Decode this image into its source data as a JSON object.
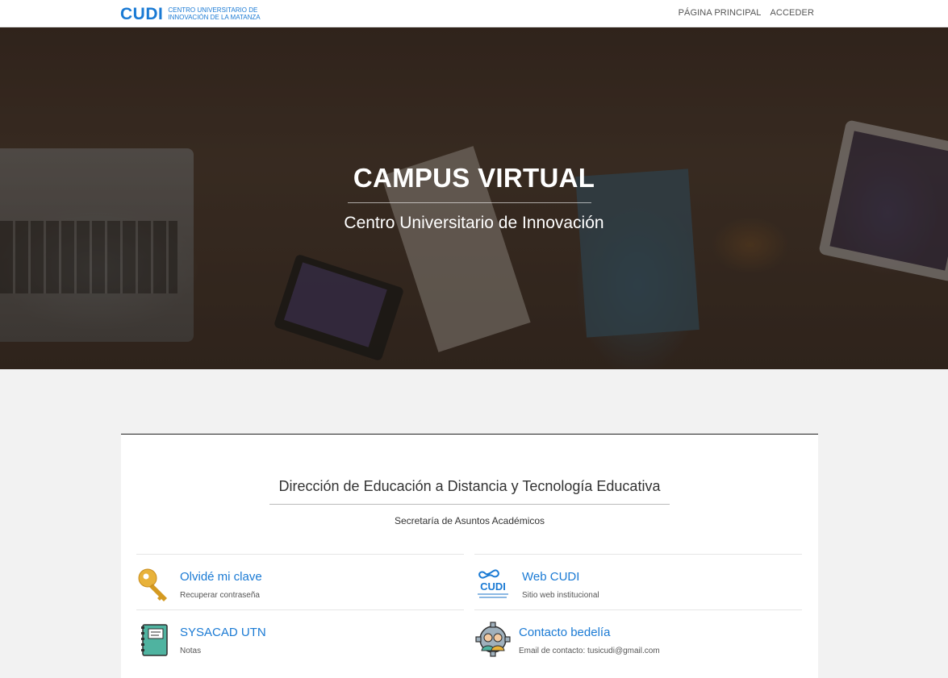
{
  "header": {
    "logo_mark": "CUDI",
    "logo_subtitle": "CENTRO UNIVERSITARIO DE INNOVACIÓN DE LA MATANZA",
    "nav": [
      {
        "label": "PÁGINA PRINCIPAL"
      },
      {
        "label": "ACCEDER"
      }
    ]
  },
  "hero": {
    "title": "CAMPUS VIRTUAL",
    "subtitle": "Centro Universitario de Innovación"
  },
  "main": {
    "title": "Dirección de Educación a Distancia y Tecnología Educativa",
    "subtitle": "Secretaría de Asuntos Académicos",
    "links": [
      {
        "title": "Olvidé mi clave",
        "description": "Recuperar contraseña",
        "icon": "key-icon"
      },
      {
        "title": "Web CUDI",
        "description": "Sitio web institucional",
        "icon": "cudi-logo-icon",
        "icon_text": "CUDI"
      },
      {
        "title": "SYSACAD UTN",
        "description": "Notas",
        "icon": "notebook-icon"
      },
      {
        "title": "Contacto bedelía",
        "description": "Email de contacto: tusicudi@gmail.com",
        "icon": "support-gear-icon"
      }
    ]
  },
  "colors": {
    "accent": "#1a7ad4",
    "page_bg": "#f2f2f2",
    "card_bg": "#ffffff"
  }
}
